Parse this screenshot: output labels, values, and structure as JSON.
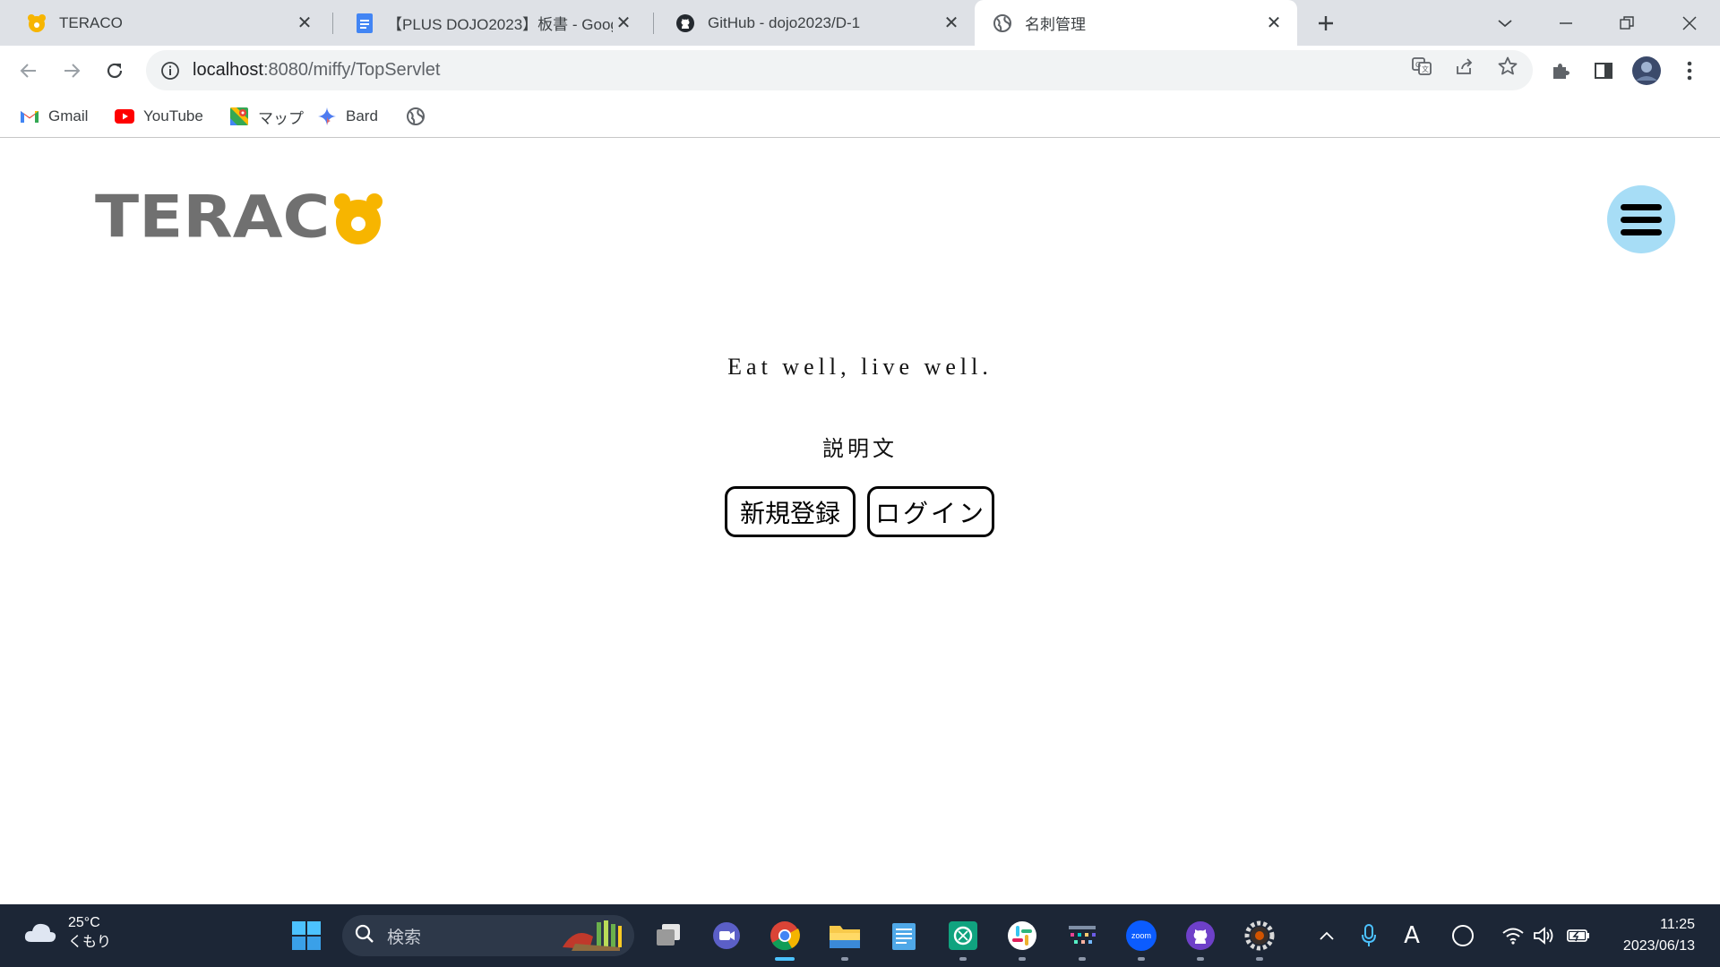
{
  "browser": {
    "tabs": [
      {
        "title": "TERACO",
        "active": false
      },
      {
        "title": "【PLUS DOJO2023】板書 - Google",
        "active": false
      },
      {
        "title": "GitHub - dojo2023/D-1",
        "active": false
      },
      {
        "title": "名刺管理",
        "active": true
      }
    ],
    "url_host": "localhost",
    "url_rest": ":8080/miffy/TopServlet"
  },
  "bookmarks": [
    {
      "label": "Gmail",
      "icon": "gmail-icon"
    },
    {
      "label": "YouTube",
      "icon": "youtube-icon"
    },
    {
      "label": "マップ",
      "icon": "maps-icon"
    },
    {
      "label": "Bard",
      "icon": "bard-icon"
    }
  ],
  "page": {
    "logo_text": "TERAC",
    "tagline": "Eat well, live well.",
    "description": "説明文",
    "register_label": "新規登録",
    "login_label": "ログイン"
  },
  "colors": {
    "logo_gray": "#707070",
    "logo_yellow": "#f7b500",
    "menu_bg": "#a7ddf6",
    "taskbar_bg": "#1c2636"
  },
  "taskbar": {
    "weather_temp": "25°C",
    "weather_desc": "くもり",
    "search_placeholder": "検索",
    "time": "11:25",
    "date": "2023/06/13",
    "ime_label": "A"
  }
}
